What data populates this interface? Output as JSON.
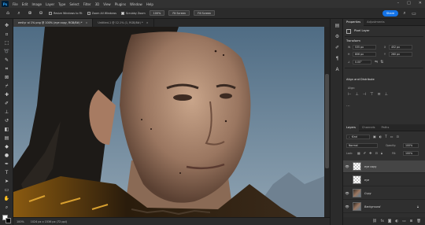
{
  "menubar": {
    "logo": "Ps",
    "items": [
      "File",
      "Edit",
      "Image",
      "Layer",
      "Type",
      "Select",
      "Filter",
      "3D",
      "View",
      "Plugins",
      "Window",
      "Help"
    ]
  },
  "optionsbar": {
    "resize_windows": "Resize Windows to Fit",
    "zoom_all": "Zoom All Windows",
    "scrubby_zoom": "Scrubby Zoom",
    "zoom_value": "100%",
    "fit_screen": "Fit Screen",
    "fill_screen": "Fill Screen",
    "share": "Share"
  },
  "tabs": [
    {
      "label": "emilyr ai 1% png @ 100% (eye copy, RGB/8#) *",
      "active": true
    },
    {
      "label": "Untitled-1 @ 12.1% (1, RGB/8#) *",
      "active": false
    }
  ],
  "statusbar": {
    "zoom": "100%",
    "info": "1024 px x 1536 px (72 ppi)"
  },
  "properties": {
    "tabs": [
      "Properties",
      "Adjustments"
    ],
    "layer_type": "Pixel Layer",
    "transform_heading": "Transform",
    "w": "535 px",
    "h": "806 px",
    "x": "452 px",
    "y": "260 px",
    "angle": "0.00°",
    "align_heading": "Align and Distribute",
    "align_label": "Align:"
  },
  "layers": {
    "tabs": [
      "Layers",
      "Channels",
      "Paths"
    ],
    "kind": "Kind",
    "blend": "Normal",
    "opacity_label": "Opacity:",
    "opacity": "100%",
    "lock_label": "Lock:",
    "fill_label": "Fill:",
    "fill": "100%",
    "rows": [
      {
        "name": "eye copy",
        "selected": true,
        "italic": false,
        "visible": true
      },
      {
        "name": "eye",
        "selected": false,
        "italic": false,
        "visible": false
      },
      {
        "name": "Copy",
        "selected": false,
        "italic": true,
        "visible": true
      },
      {
        "name": "Background",
        "selected": false,
        "italic": true,
        "visible": true
      }
    ]
  },
  "colors": {
    "accent": "#1473e6",
    "panel_bg": "#2f2f2f",
    "selected_layer": "#454545"
  }
}
